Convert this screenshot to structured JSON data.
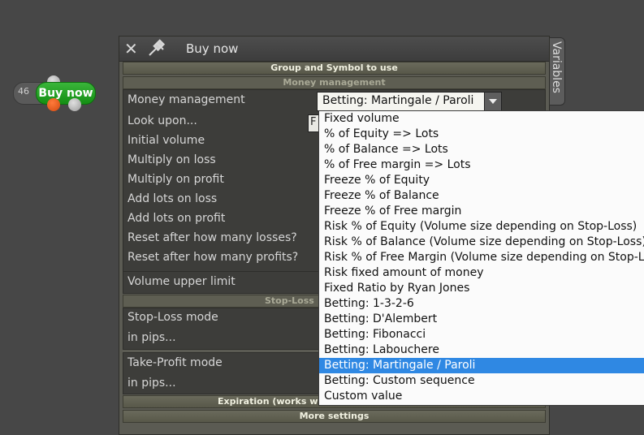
{
  "node": {
    "count": "46",
    "label": "Buy now"
  },
  "window": {
    "title": "Buy now",
    "variables_tab": "Variables"
  },
  "sections": {
    "group_symbol": "Group and Symbol to use",
    "money_management": "Money management",
    "stop_loss": "Stop-Loss",
    "expiration": "Expiration (works w",
    "more_settings": "More settings"
  },
  "rows": {
    "money_management": "Money management",
    "look_upon": "Look upon...",
    "initial_volume": "Initial volume",
    "multiply_on_loss": "Multiply on loss",
    "multiply_on_profit": "Multiply on profit",
    "add_lots_on_loss": "Add lots on loss",
    "add_lots_on_profit": "Add lots on profit",
    "reset_after_losses": "Reset after how many losses?",
    "reset_after_profits": "Reset after how many profits?",
    "volume_upper_limit": "Volume upper limit",
    "stop_loss_mode": "Stop-Loss mode",
    "sl_in_pips": "in pips...",
    "take_profit_mode": "Take-Profit mode",
    "tp_in_pips": "in pips..."
  },
  "combo": {
    "value": "Betting: Martingale / Paroli"
  },
  "look_upon_field": "F",
  "dropdown_options": [
    "Fixed volume",
    "% of Equity => Lots",
    "% of Balance => Lots",
    "% of Free margin => Lots",
    "Freeze % of Equity",
    "Freeze % of Balance",
    "Freeze % of Free margin",
    "Risk % of Equity (Volume size depending on Stop-Loss)",
    "Risk % of Balance (Volume size depending on Stop-Loss)",
    "Risk % of Free Margin (Volume size depending on Stop-L",
    "Risk fixed amount of money",
    "Fixed Ratio by Ryan Jones",
    "Betting: 1-3-2-6",
    "Betting: D'Alembert",
    "Betting: Fibonacci",
    "Betting: Labouchere",
    "Betting: Martingale / Paroli",
    "Betting: Custom sequence",
    "Custom value"
  ],
  "selected_option": "Betting: Martingale / Paroli",
  "colors": {
    "selection": "#2f88e3",
    "node_green": "#148f14",
    "node_orange": "#d24a10"
  }
}
